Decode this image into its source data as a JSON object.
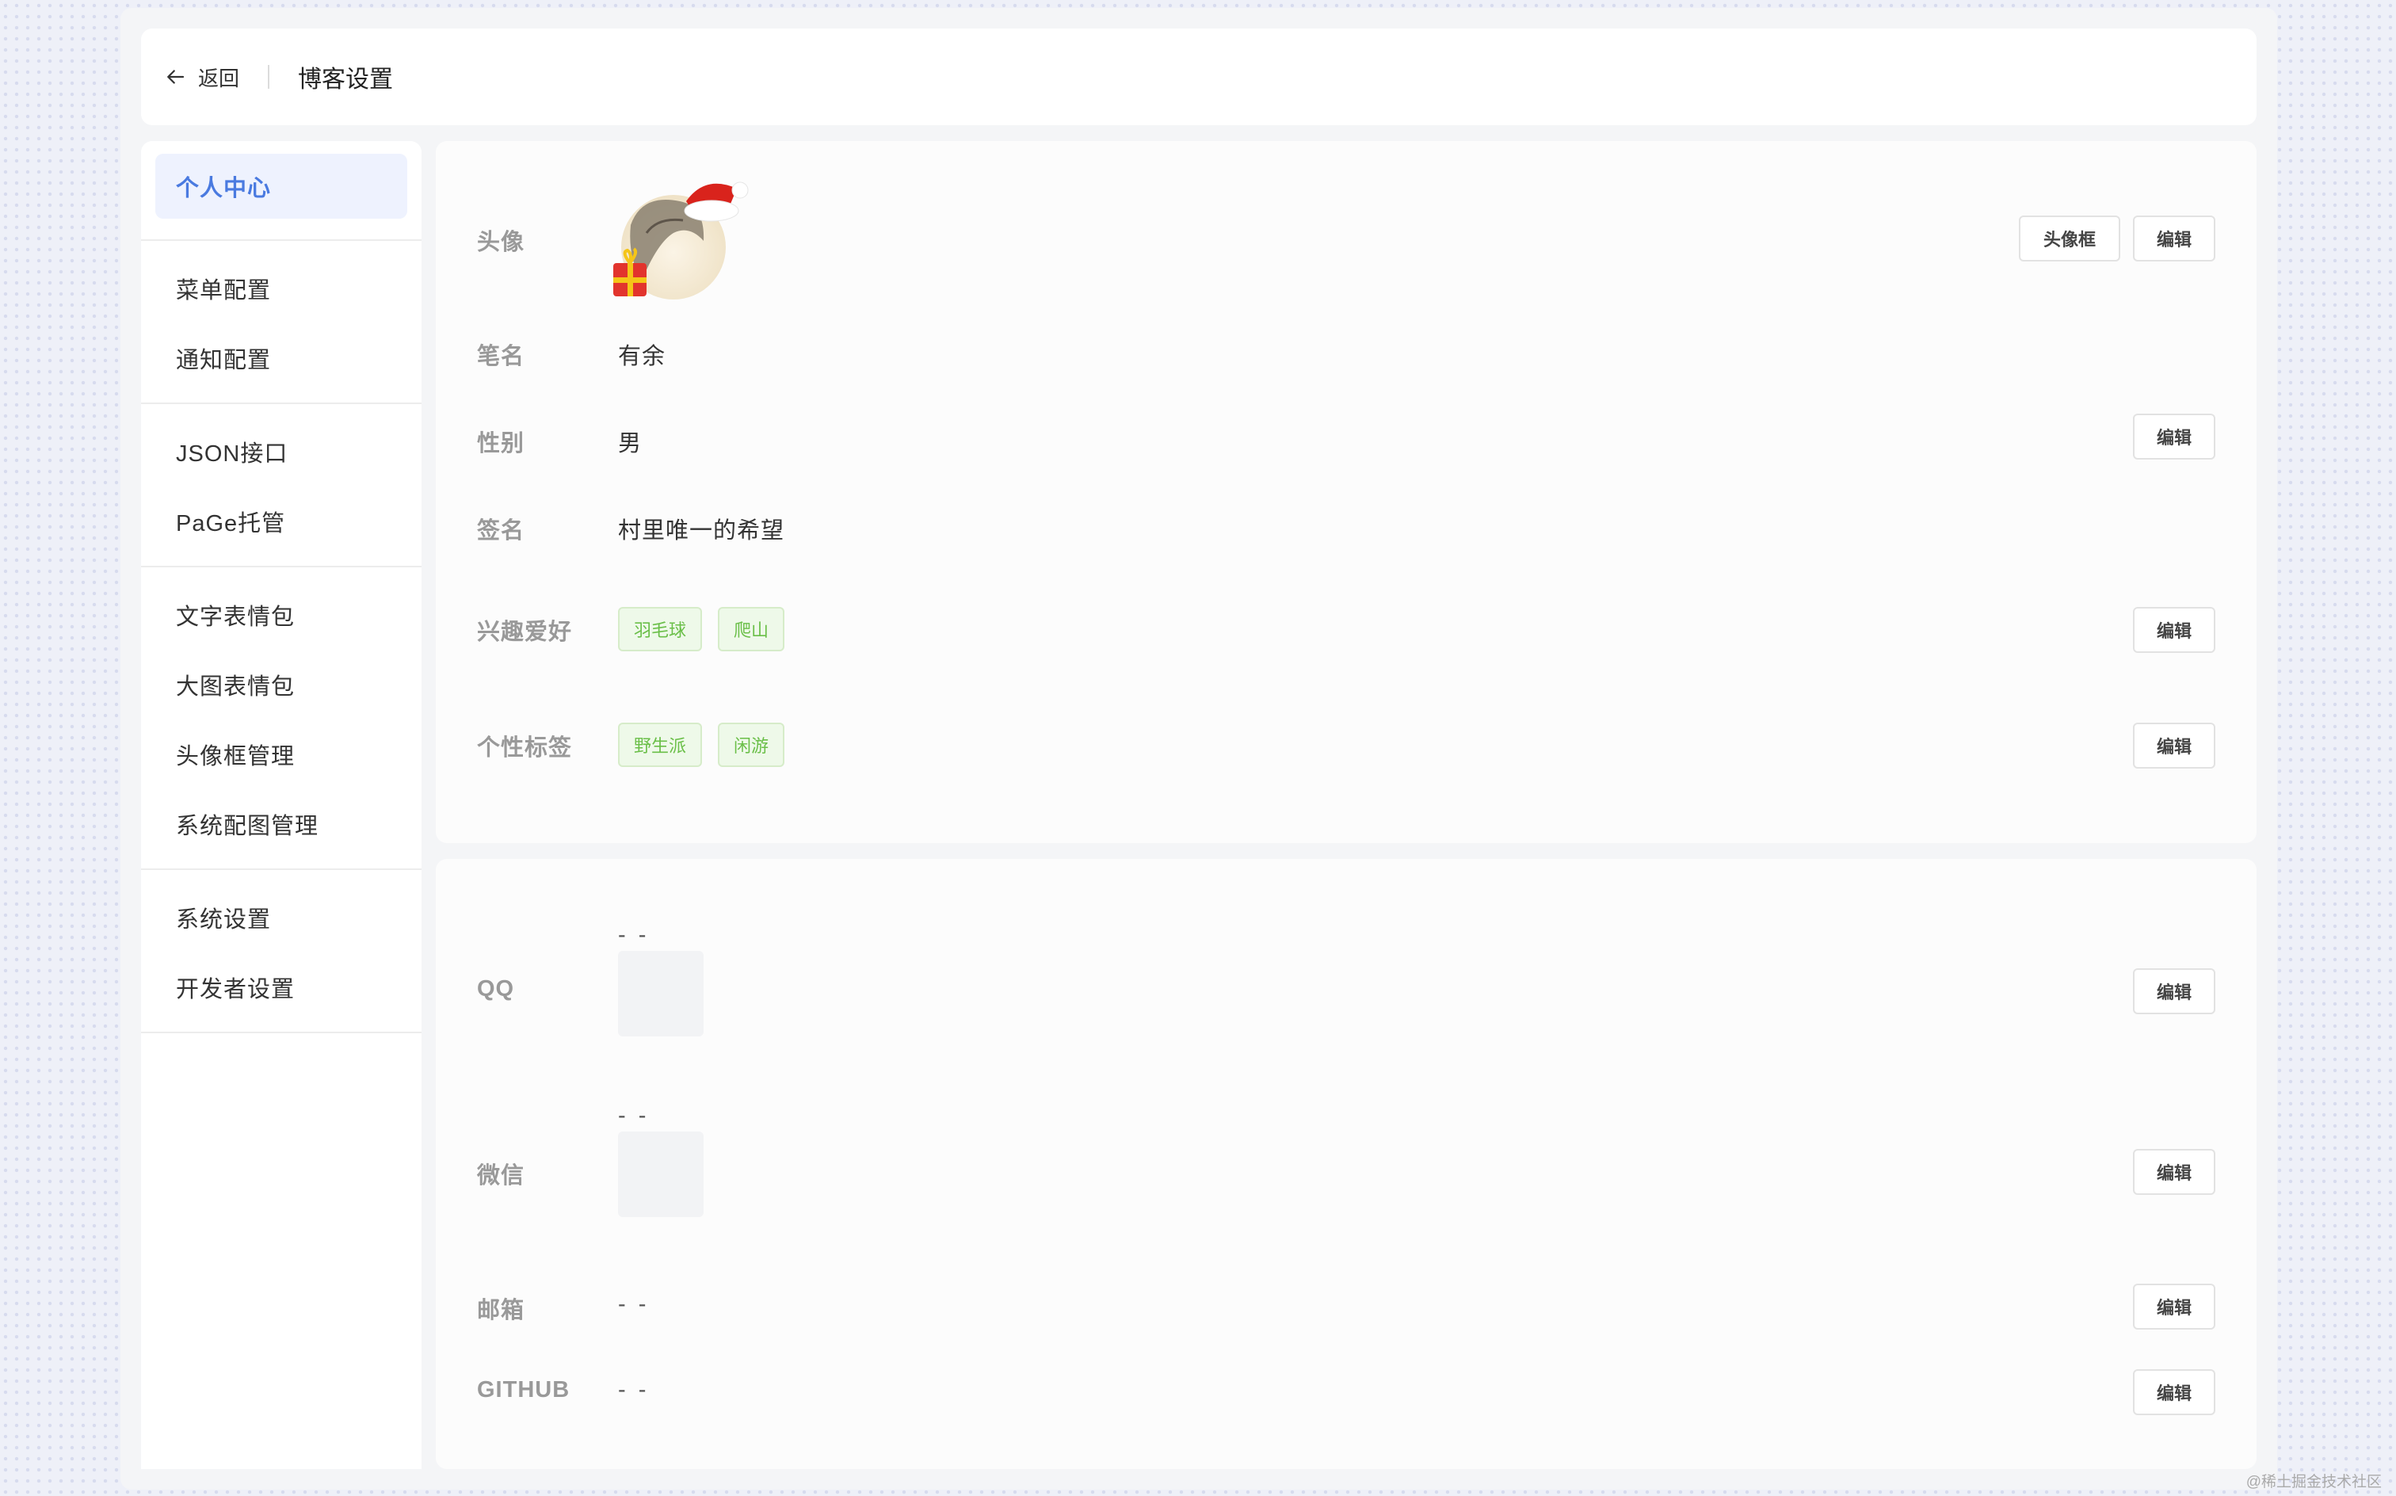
{
  "header": {
    "back_label": "返回",
    "title": "博客设置"
  },
  "sidebar": {
    "groups": [
      [
        "个人中心"
      ],
      [
        "菜单配置",
        "通知配置"
      ],
      [
        "JSON接口",
        "PaGe托管"
      ],
      [
        "文字表情包",
        "大图表情包",
        "头像框管理",
        "系统配图管理"
      ],
      [
        "系统设置",
        "开发者设置"
      ]
    ],
    "active": "个人中心"
  },
  "profile": {
    "avatar_label": "头像",
    "avatar_frame_button": "头像框",
    "edit_button": "编辑",
    "penname_label": "笔名",
    "penname_value": "有余",
    "gender_label": "性别",
    "gender_value": "男",
    "signature_label": "签名",
    "signature_value": "村里唯一的希望",
    "hobbies_label": "兴趣爱好",
    "hobbies": [
      "羽毛球",
      "爬山"
    ],
    "tags_label": "个性标签",
    "tags": [
      "野生派",
      "闲游"
    ]
  },
  "contact": {
    "qq_label": "QQ",
    "qq_value": "- -",
    "wechat_label": "微信",
    "wechat_value": "- -",
    "email_label": "邮箱",
    "email_value": "- -",
    "github_label": "GITHUB",
    "github_value": "- -",
    "edit_button": "编辑"
  },
  "watermark": "@稀土掘金技术社区",
  "colors": {
    "accent": "#4a7ae0",
    "tag_green": "#6abf48",
    "tag_bg": "#eef9e9"
  }
}
